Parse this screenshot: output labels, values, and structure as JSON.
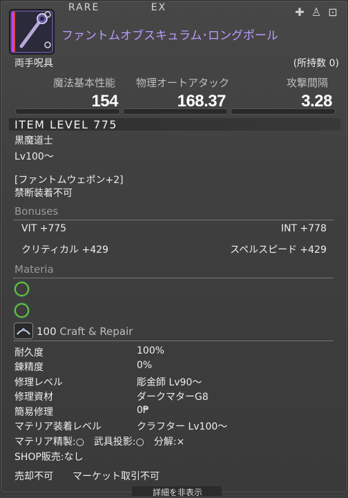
{
  "header": {
    "rarity_tag": "RARE",
    "ex_tag": "EX"
  },
  "item": {
    "name": "ファントムオブスキュラム･ロングポール",
    "type": "両手呪具",
    "owned": "(所持数 0)",
    "icon": "staff-icon"
  },
  "stats": [
    {
      "label": "魔法基本性能",
      "value": "154"
    },
    {
      "label": "物理オートアタック",
      "value": "168.37"
    },
    {
      "label": "攻撃間隔",
      "value": "3.28"
    }
  ],
  "item_level": "ITEM LEVEL 775",
  "job": "黒魔道士",
  "level_req": "Lv100～",
  "notes": [
    "[ファントムウェポン+2]",
    "禁断装着不可"
  ],
  "bonuses": {
    "title": "Bonuses",
    "items": [
      {
        "label": "VIT +775"
      },
      {
        "label": "INT +778"
      },
      {
        "label": "クリティカル +429"
      },
      {
        "label": "スペルスピード +429"
      }
    ]
  },
  "materia": {
    "title": "Materia",
    "slots": 2
  },
  "craft": {
    "title_prefix": "100",
    "title": "Craft & Repair",
    "rows": [
      {
        "label": "耐久度",
        "value": "100%"
      },
      {
        "label": "錬精度",
        "value": "0%"
      },
      {
        "label": "修理レベル",
        "value": "彫金師 Lv90～"
      },
      {
        "label": "修理資材",
        "value": "ダークマターG8"
      },
      {
        "label": "簡易修理",
        "value": "0₱"
      },
      {
        "label": "マテリア装着レベル",
        "value": "クラフター Lv100～"
      }
    ],
    "flags_line": "マテリア精製:○　武具投影:○　分解:×",
    "shop_line": "SHOP販売:なし",
    "trade_line": "売却不可　　マーケット取引不可"
  },
  "footer": {
    "hide_details": "詳細を非表示"
  },
  "colors": {
    "name": "#b99cff",
    "green": "#8fdc57"
  }
}
